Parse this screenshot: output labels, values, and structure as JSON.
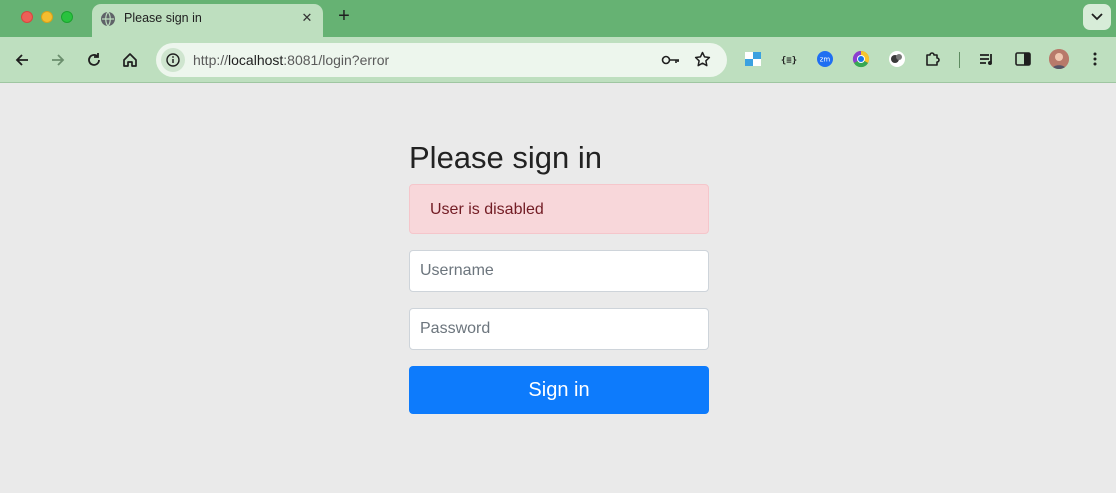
{
  "browser": {
    "tab_title": "Please sign in",
    "tab_close": "✕",
    "new_tab": "+",
    "url_scheme": "http://",
    "url_host": "localhost",
    "url_rest": ":8081/login?error"
  },
  "icons": {
    "tab": "globe-icon",
    "back": "arrow-left-icon",
    "forward": "arrow-right-icon",
    "reload": "reload-icon",
    "home": "home-icon",
    "site_info": "info-icon",
    "password": "key-icon",
    "bookmark": "star-icon",
    "extensions": [
      "calendar-extension-icon",
      "json-extension-icon",
      "zoom-extension-icon",
      "chrome-extension-icon",
      "bitwarden-extension-icon",
      "puzzle-icon"
    ],
    "media": "media-control-icon",
    "side_panel": "side-panel-icon",
    "menu": "kebab-menu-icon"
  },
  "colors": {
    "tab_strip": "#66b273",
    "toolbar": "#bedfbf",
    "alert_bg": "#f8d7da",
    "alert_text": "#721c24",
    "primary": "#0d7bfc"
  },
  "page": {
    "heading": "Please sign in",
    "error_message": "User is disabled",
    "username_placeholder": "Username",
    "password_placeholder": "Password",
    "submit_label": "Sign in"
  }
}
